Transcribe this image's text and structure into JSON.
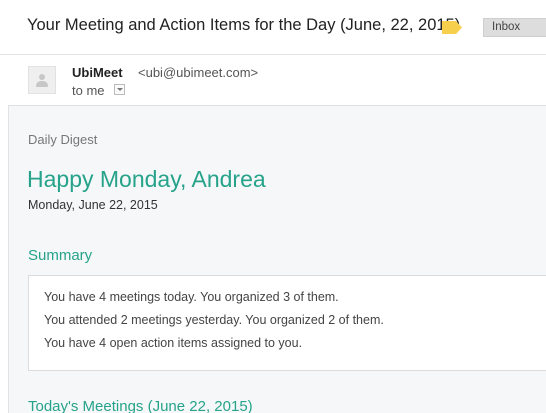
{
  "email": {
    "subject": "Your Meeting and Action Items for the Day (June, 22, 2015)",
    "label_color": "#f6d04d",
    "inbox_label": "Inbox"
  },
  "sender": {
    "name": "UbiMeet",
    "email": "<ubi@ubimeet.com>",
    "to": "to me",
    "avatar_icon": "person-icon"
  },
  "digest": {
    "label": "Daily Digest",
    "greeting": "Happy Monday, Andrea",
    "date": "Monday, June 22, 2015",
    "accent_color": "#26a38a"
  },
  "summary": {
    "heading": "Summary",
    "lines": [
      "You have 4 meetings today. You organized 3 of them.",
      "You attended 2 meetings yesterday. You organized 2 of them.",
      "You have 4 open action items assigned to you."
    ]
  },
  "meetings": {
    "heading": "Today's Meetings (June 22, 2015)"
  }
}
